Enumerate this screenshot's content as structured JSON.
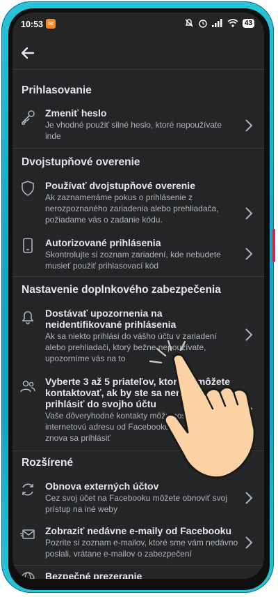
{
  "status_bar": {
    "time": "10:53",
    "battery": "43"
  },
  "header": {
    "back_icon": "arrow-left-icon"
  },
  "sections": [
    {
      "title": "Prihlasovanie",
      "items": [
        {
          "icon": "key-icon",
          "title": "Zmeniť heslo",
          "desc": "Je vhodné použiť silné heslo, ktoré nepoužívate inde"
        }
      ]
    },
    {
      "title": "Dvojstupňové overenie",
      "items": [
        {
          "icon": "shield-icon",
          "title": "Používať dvojstupňové overenie",
          "desc": "Ak zaznamenáme pokus o prihlásenie z nerozpoznaného zariadenia alebo prehliadača, požiadame vás o zadanie kódu."
        },
        {
          "icon": "phone-icon",
          "title": "Autorizované prihlásenia",
          "desc": "Skontrolujte si zoznam zariadení, kde nebudete musieť použiť prihlasovací kód"
        }
      ]
    },
    {
      "title": "Nastavenie doplnkového zabezpečenia",
      "items": [
        {
          "icon": "bell-icon",
          "title": "Dostávať upozornenia na neidentifikované prihlásenia",
          "desc": "Ak sa niekto prihlási do vášho účtu v zariadení alebo prehliadači, ktorý bežne nepoužívate, upozorníme vás na to"
        },
        {
          "icon": "friends-icon",
          "title": "Vyberte 3 až 5 priateľov, ktorých môžete kontaktovať, ak by ste sa nemohli prihlásiť do svojho účtu",
          "desc": "Vaše dôveryhodné kontakty môžu poslať kód a internetovú adresu od Facebooku, aby vám pomohli znova sa prihlásiť"
        }
      ]
    },
    {
      "title": "Rozšírené",
      "items": [
        {
          "icon": "sync-icon",
          "title": "Obnova externých účtov",
          "desc": "Cez svoj účet na Facebooku môžete obnoviť svoj prístup na iné weby"
        },
        {
          "icon": "mail-icon",
          "title": "Zobraziť nedávne e-maily od Facebooku",
          "desc": "Pozrite si zoznam e-mailov, ktoré sme vám nedávno poslali, vrátane e-mailov o zabezpečení"
        },
        {
          "icon": "globe-icon",
          "title": "Bezpečné prezeranie",
          "desc": ""
        }
      ]
    }
  ]
}
